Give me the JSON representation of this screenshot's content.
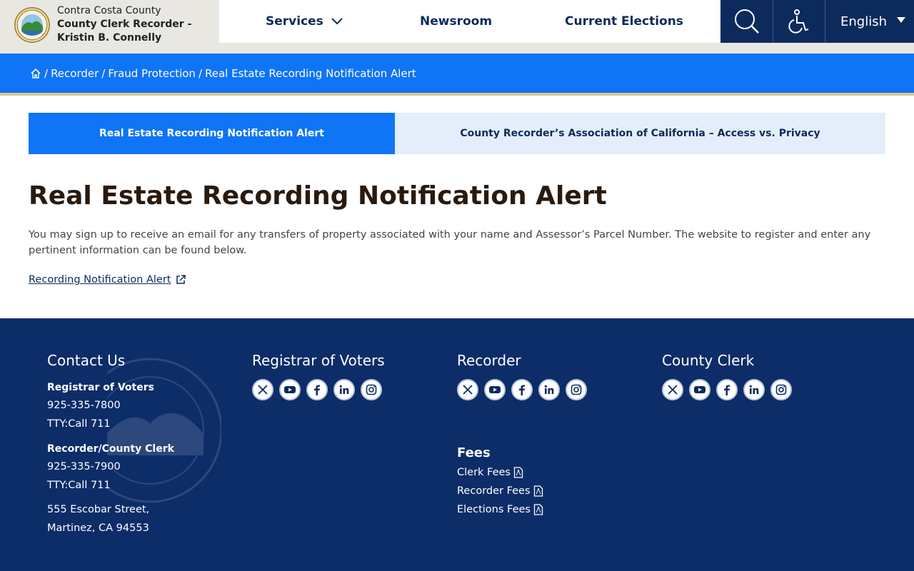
{
  "brand": {
    "line1": "Contra Costa County",
    "line2": "County Clerk Recorder -",
    "line3": "Kristin B. Connelly"
  },
  "nav": {
    "services": "Services",
    "newsroom": "Newsroom",
    "elections": "Current Elections",
    "language": "English"
  },
  "breadcrumb": {
    "items": [
      "Recorder",
      "Fraud Protection",
      "Real Estate Recording Notification Alert"
    ]
  },
  "tabs": [
    {
      "label": "Real Estate Recording Notification Alert",
      "active": true
    },
    {
      "label": "County Recorder’s Association of California – Access vs. Privacy",
      "active": false
    }
  ],
  "main": {
    "title": "Real Estate Recording Notification Alert",
    "intro": "You may sign up to receive an email for any transfers of property associated with your name and Assessor’s Parcel Number.  The website to register and enter any pertinent information can be found below.",
    "link_label": "Recording Notification Alert"
  },
  "footer": {
    "contact": {
      "heading": "Contact Us",
      "rov_label": "Registrar of Voters",
      "rov_phone": "925-335-7800",
      "rov_tty": "TTY:Call 711",
      "rec_label": "Recorder/County Clerk",
      "rec_phone": "925-335-7900",
      "rec_tty": "TTY:Call 711",
      "address1": "555 Escobar Street,",
      "address2": "Martinez, CA 94553"
    },
    "rov_heading": "Registrar of Voters",
    "recorder_heading": "Recorder",
    "clerk_heading": "County Clerk",
    "fees": {
      "heading": "Fees",
      "items": [
        "Clerk Fees",
        "Recorder Fees",
        "Elections Fees"
      ]
    }
  },
  "icons": {
    "social": [
      "x-icon",
      "youtube-icon",
      "facebook-icon",
      "linkedin-icon",
      "instagram-icon"
    ]
  },
  "colors": {
    "navy": "#0c2b5c",
    "blue": "#0f74f5",
    "footer": "#0c2d68",
    "tab_inactive": "#e4eefa"
  }
}
